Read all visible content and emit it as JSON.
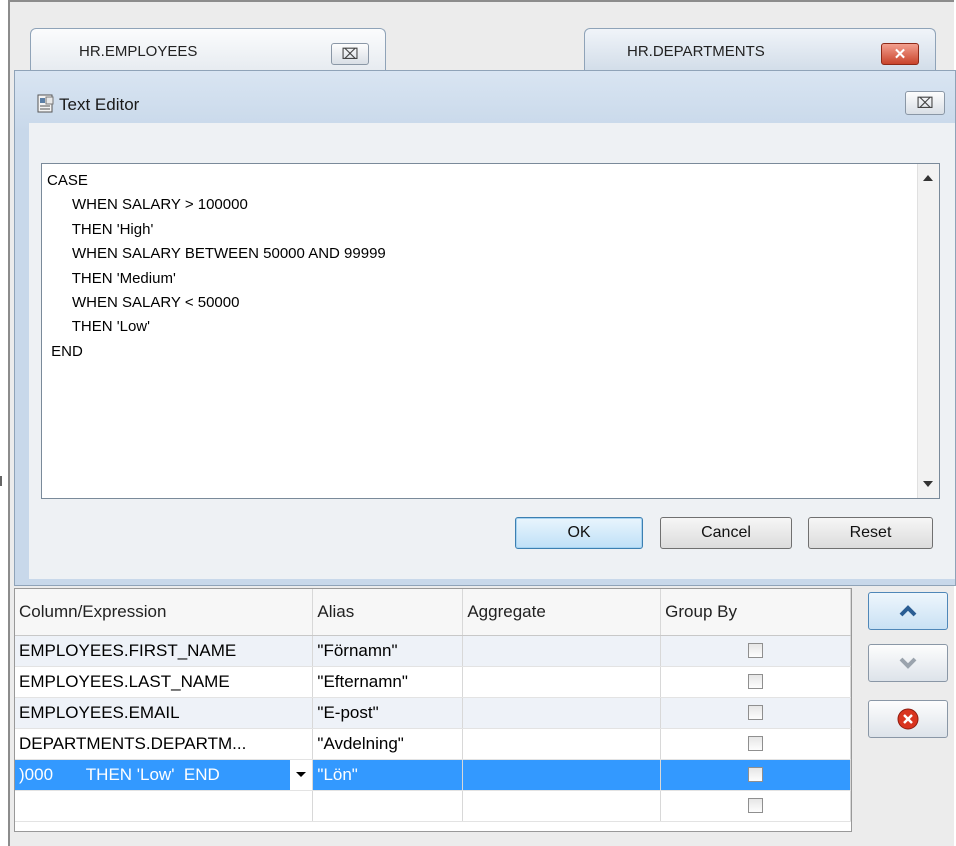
{
  "tabs": [
    {
      "label": "HR.EMPLOYEES",
      "close": "⌧"
    },
    {
      "label": "HR.DEPARTMENTS",
      "close": "✕"
    }
  ],
  "dialog": {
    "title": "Text Editor",
    "close": "⌧",
    "editor_text": "CASE\n      WHEN SALARY > 100000\n      THEN 'High'\n      WHEN SALARY BETWEEN 50000 AND 99999\n      THEN 'Medium'\n      WHEN SALARY < 50000\n      THEN 'Low'\n END",
    "buttons": {
      "ok": "OK",
      "cancel": "Cancel",
      "reset": "Reset"
    }
  },
  "grid": {
    "headers": [
      "Column/Expression",
      "Alias",
      "Aggregate",
      "Group By"
    ],
    "rows": [
      {
        "expr": "EMPLOYEES.FIRST_NAME",
        "alias": "\"Förnamn\"",
        "aggregate": "",
        "group_by": false
      },
      {
        "expr": "EMPLOYEES.LAST_NAME",
        "alias": "\"Efternamn\"",
        "aggregate": "",
        "group_by": false
      },
      {
        "expr": "EMPLOYEES.EMAIL",
        "alias": "\"E-post\"",
        "aggregate": "",
        "group_by": false
      },
      {
        "expr": "DEPARTMENTS.DEPARTM...",
        "alias": "\"Avdelning\"",
        "aggregate": "",
        "group_by": false
      },
      {
        "expr": ")000       THEN 'Low'  END",
        "alias": "\"Lön\"",
        "aggregate": "",
        "group_by": false
      },
      {
        "expr": "",
        "alias": "",
        "aggregate": "",
        "group_by": false
      }
    ]
  },
  "side_buttons": {
    "up": "chevron-up-icon",
    "down": "chevron-down-icon",
    "delete": "delete-icon"
  },
  "colors": {
    "selection": "#3399ff",
    "dialog_bg": "#c8d8ea",
    "delete_red": "#d9341f"
  }
}
